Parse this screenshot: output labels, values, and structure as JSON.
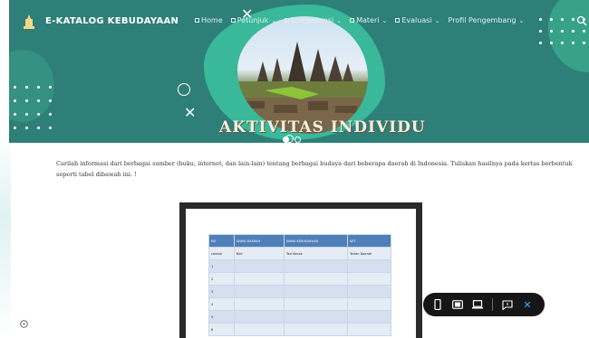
{
  "brand": {
    "name": "E-KATALOG KEBUDAYAAN",
    "logo_icon": "mosque-logo-icon"
  },
  "nav": {
    "items": [
      {
        "label": "Home",
        "has_icon": true,
        "dropdown": false
      },
      {
        "label": "Petunjuk",
        "has_icon": true,
        "dropdown": true
      },
      {
        "label": "Kompetensi",
        "has_icon": true,
        "dropdown": true
      },
      {
        "label": "Materi",
        "has_icon": true,
        "dropdown": true
      },
      {
        "label": "Evaluasi",
        "has_icon": true,
        "dropdown": true
      },
      {
        "label": "Profil Pengembang",
        "has_icon": false,
        "dropdown": true
      }
    ],
    "search_icon": "search-icon"
  },
  "banner": {
    "title": "AKTIVITAS INDIVIDU"
  },
  "content": {
    "instruction": "Carilah informasi dari berbagai sumber (buku, internet, dan lain-lain) tentang berbagai budaya dari beberapa daerah di Indonesia. Tuliskan hasilnya pada kertas berbentuk seperti tabel dibawah ini. !"
  },
  "document": {
    "headers": [
      "NO",
      "NAMA DAERAH",
      "NAMA KEBUDAYAAN",
      "KET"
    ],
    "rows": [
      [
        "contoh",
        "Bali",
        "Tari Kecak",
        "Tarian Daerah"
      ],
      [
        "1",
        "",
        "",
        ""
      ],
      [
        "2",
        "",
        "",
        ""
      ],
      [
        "3",
        "",
        "",
        ""
      ],
      [
        "4",
        "",
        "",
        ""
      ],
      [
        "5",
        "",
        "",
        ""
      ],
      [
        "6",
        "",
        "",
        ""
      ]
    ]
  },
  "toolbar": {
    "buttons": [
      "mobile-view-icon",
      "tablet-view-icon",
      "laptop-view-icon",
      "comment-icon",
      "close-icon"
    ],
    "close_label": "✕"
  },
  "colors": {
    "banner": "#2e7f78",
    "accent": "#39b89a",
    "table_header": "#4f7fb8",
    "toolbar": "#161616"
  }
}
